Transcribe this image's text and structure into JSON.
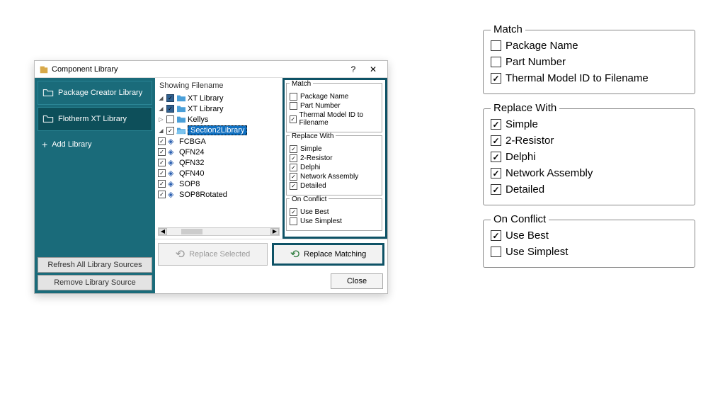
{
  "dialog": {
    "title": "Component Library",
    "help_label": "?",
    "close_label": "✕"
  },
  "sidebar": {
    "items": [
      {
        "label": "Package Creator Library"
      },
      {
        "label": "Flotherm XT Library"
      }
    ],
    "add_label": "Add Library",
    "refresh_label": "Refresh All Library Sources",
    "remove_label": "Remove Library Source"
  },
  "tree": {
    "header": "Showing Filename",
    "root1": "XT Library",
    "root2": "XT Library",
    "folder_kellys": "Kellys",
    "folder_section": "Section2Library",
    "items": [
      "FCBGA",
      "QFN24",
      "QFN32",
      "QFN40",
      "SOP8",
      "SOP8Rotated"
    ]
  },
  "options": {
    "match": {
      "legend": "Match",
      "package_name": "Package Name",
      "part_number": "Part Number",
      "thermal_id": "Thermal Model ID to Filename"
    },
    "replace": {
      "legend": "Replace With",
      "simple": "Simple",
      "two_resistor": "2-Resistor",
      "delphi": "Delphi",
      "network": "Network Assembly",
      "detailed": "Detailed"
    },
    "conflict": {
      "legend": "On Conflict",
      "use_best": "Use Best",
      "use_simplest": "Use Simplest"
    }
  },
  "actions": {
    "replace_selected": "Replace Selected",
    "replace_matching": "Replace Matching",
    "close": "Close"
  }
}
